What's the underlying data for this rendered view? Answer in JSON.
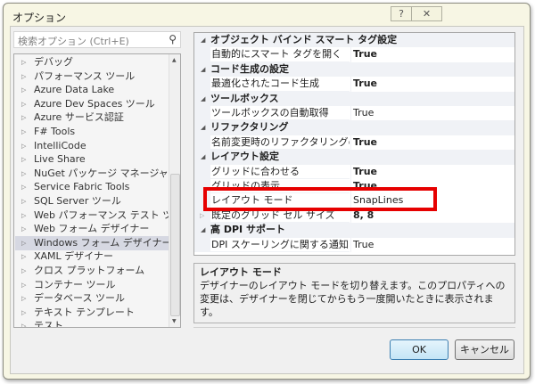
{
  "window": {
    "title": "オプション",
    "help_label": "?",
    "close_label": "✕"
  },
  "search": {
    "placeholder": "検索オプション (Ctrl+E)"
  },
  "tree": {
    "items": [
      "デバッグ",
      "パフォーマンス ツール",
      "Azure Data Lake",
      "Azure Dev Spaces ツール",
      "Azure サービス認証",
      "F# Tools",
      "IntelliCode",
      "Live Share",
      "NuGet パッケージ マネージャー",
      "Service Fabric Tools",
      "SQL Server ツール",
      "Web パフォーマンス テスト ツール",
      "Web フォーム デザイナー",
      "Windows フォーム デザイナー",
      "XAML デザイナー",
      "クロス プラットフォーム",
      "コンテナー ツール",
      "データベース ツール",
      "テキスト テンプレート",
      "テスト"
    ],
    "selected": "Windows フォーム デザイナー"
  },
  "grid": {
    "rows": [
      {
        "type": "cat",
        "label": "オブジェクト バインド スマート タグ設定"
      },
      {
        "type": "prop",
        "name": "自動的にスマート タグを開く",
        "value": "True",
        "bold": true
      },
      {
        "type": "cat",
        "label": "コード生成の設定"
      },
      {
        "type": "prop",
        "name": "最適化されたコード生成",
        "value": "True",
        "bold": true
      },
      {
        "type": "cat",
        "label": "ツールボックス"
      },
      {
        "type": "prop",
        "name": "ツールボックスの自動取得",
        "value": "True",
        "bold": false
      },
      {
        "type": "cat",
        "label": "リファクタリング"
      },
      {
        "type": "prop",
        "name": "名前変更時のリファクタリングの有効",
        "value": "True",
        "bold": true
      },
      {
        "type": "cat",
        "label": "レイアウト設定"
      },
      {
        "type": "prop",
        "name": "グリッドに合わせる",
        "value": "True",
        "bold": true
      },
      {
        "type": "prop",
        "name": "グリッドの表示",
        "value": "True",
        "bold": true
      },
      {
        "type": "prop",
        "name": "レイアウト モード",
        "value": "SnapLines",
        "bold": false
      },
      {
        "type": "prop",
        "name": "既定のグリッド セル サイズ",
        "value": "8, 8",
        "bold": true,
        "expandable": true
      },
      {
        "type": "cat",
        "label": "高 DPI サポート"
      },
      {
        "type": "prop",
        "name": "DPI スケーリングに関する通知",
        "value": "True",
        "bold": false
      }
    ]
  },
  "description": {
    "title": "レイアウト モード",
    "text": "デザイナーのレイアウト モードを切り替えます。このプロパティへの変更は、デザイナーを閉じてからもう一度開いたときに表示されます。"
  },
  "buttons": {
    "ok": "OK",
    "cancel": "キャンセル"
  },
  "colors": {
    "highlight": "#e60000",
    "selection": "#d6d8e2"
  }
}
